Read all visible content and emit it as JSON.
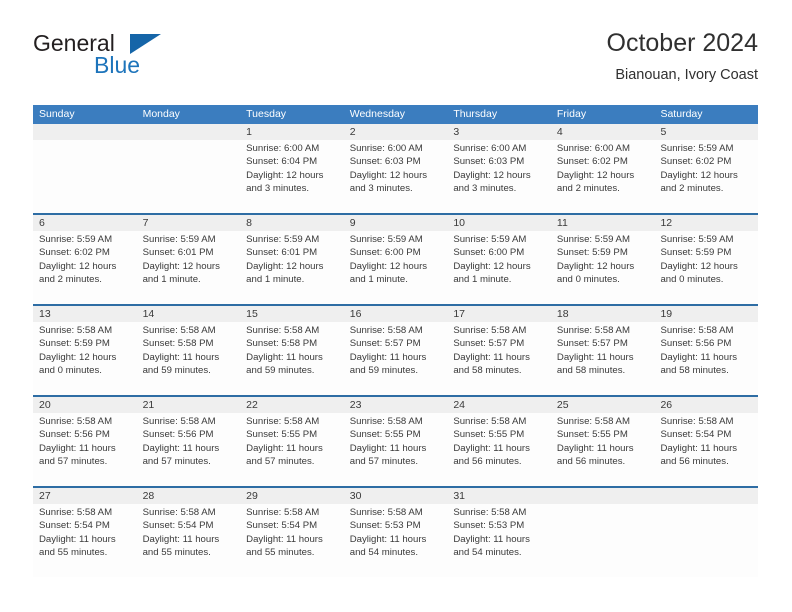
{
  "brand": {
    "name_part1": "General",
    "name_part2": "Blue",
    "flag_icon": "blue-triangle-flag"
  },
  "header": {
    "title": "October 2024",
    "subtitle": "Bianouan, Ivory Coast"
  },
  "colors": {
    "header_blue": "#3b7dbf",
    "rule_blue": "#2e6da4",
    "daynum_band": "#efefef",
    "brand_blue": "#1d74bb",
    "text": "#3a3a3a"
  },
  "weekday_headers": [
    "Sunday",
    "Monday",
    "Tuesday",
    "Wednesday",
    "Thursday",
    "Friday",
    "Saturday"
  ],
  "weeks": [
    {
      "days": [
        {
          "num": "",
          "lines": [
            "",
            "",
            "",
            ""
          ]
        },
        {
          "num": "",
          "lines": [
            "",
            "",
            "",
            ""
          ]
        },
        {
          "num": "1",
          "lines": [
            "Sunrise: 6:00 AM",
            "Sunset: 6:04 PM",
            "Daylight: 12 hours",
            "and 3 minutes."
          ]
        },
        {
          "num": "2",
          "lines": [
            "Sunrise: 6:00 AM",
            "Sunset: 6:03 PM",
            "Daylight: 12 hours",
            "and 3 minutes."
          ]
        },
        {
          "num": "3",
          "lines": [
            "Sunrise: 6:00 AM",
            "Sunset: 6:03 PM",
            "Daylight: 12 hours",
            "and 3 minutes."
          ]
        },
        {
          "num": "4",
          "lines": [
            "Sunrise: 6:00 AM",
            "Sunset: 6:02 PM",
            "Daylight: 12 hours",
            "and 2 minutes."
          ]
        },
        {
          "num": "5",
          "lines": [
            "Sunrise: 5:59 AM",
            "Sunset: 6:02 PM",
            "Daylight: 12 hours",
            "and 2 minutes."
          ]
        }
      ]
    },
    {
      "days": [
        {
          "num": "6",
          "lines": [
            "Sunrise: 5:59 AM",
            "Sunset: 6:02 PM",
            "Daylight: 12 hours",
            "and 2 minutes."
          ]
        },
        {
          "num": "7",
          "lines": [
            "Sunrise: 5:59 AM",
            "Sunset: 6:01 PM",
            "Daylight: 12 hours",
            "and 1 minute."
          ]
        },
        {
          "num": "8",
          "lines": [
            "Sunrise: 5:59 AM",
            "Sunset: 6:01 PM",
            "Daylight: 12 hours",
            "and 1 minute."
          ]
        },
        {
          "num": "9",
          "lines": [
            "Sunrise: 5:59 AM",
            "Sunset: 6:00 PM",
            "Daylight: 12 hours",
            "and 1 minute."
          ]
        },
        {
          "num": "10",
          "lines": [
            "Sunrise: 5:59 AM",
            "Sunset: 6:00 PM",
            "Daylight: 12 hours",
            "and 1 minute."
          ]
        },
        {
          "num": "11",
          "lines": [
            "Sunrise: 5:59 AM",
            "Sunset: 5:59 PM",
            "Daylight: 12 hours",
            "and 0 minutes."
          ]
        },
        {
          "num": "12",
          "lines": [
            "Sunrise: 5:59 AM",
            "Sunset: 5:59 PM",
            "Daylight: 12 hours",
            "and 0 minutes."
          ]
        }
      ]
    },
    {
      "days": [
        {
          "num": "13",
          "lines": [
            "Sunrise: 5:58 AM",
            "Sunset: 5:59 PM",
            "Daylight: 12 hours",
            "and 0 minutes."
          ]
        },
        {
          "num": "14",
          "lines": [
            "Sunrise: 5:58 AM",
            "Sunset: 5:58 PM",
            "Daylight: 11 hours",
            "and 59 minutes."
          ]
        },
        {
          "num": "15",
          "lines": [
            "Sunrise: 5:58 AM",
            "Sunset: 5:58 PM",
            "Daylight: 11 hours",
            "and 59 minutes."
          ]
        },
        {
          "num": "16",
          "lines": [
            "Sunrise: 5:58 AM",
            "Sunset: 5:57 PM",
            "Daylight: 11 hours",
            "and 59 minutes."
          ]
        },
        {
          "num": "17",
          "lines": [
            "Sunrise: 5:58 AM",
            "Sunset: 5:57 PM",
            "Daylight: 11 hours",
            "and 58 minutes."
          ]
        },
        {
          "num": "18",
          "lines": [
            "Sunrise: 5:58 AM",
            "Sunset: 5:57 PM",
            "Daylight: 11 hours",
            "and 58 minutes."
          ]
        },
        {
          "num": "19",
          "lines": [
            "Sunrise: 5:58 AM",
            "Sunset: 5:56 PM",
            "Daylight: 11 hours",
            "and 58 minutes."
          ]
        }
      ]
    },
    {
      "days": [
        {
          "num": "20",
          "lines": [
            "Sunrise: 5:58 AM",
            "Sunset: 5:56 PM",
            "Daylight: 11 hours",
            "and 57 minutes."
          ]
        },
        {
          "num": "21",
          "lines": [
            "Sunrise: 5:58 AM",
            "Sunset: 5:56 PM",
            "Daylight: 11 hours",
            "and 57 minutes."
          ]
        },
        {
          "num": "22",
          "lines": [
            "Sunrise: 5:58 AM",
            "Sunset: 5:55 PM",
            "Daylight: 11 hours",
            "and 57 minutes."
          ]
        },
        {
          "num": "23",
          "lines": [
            "Sunrise: 5:58 AM",
            "Sunset: 5:55 PM",
            "Daylight: 11 hours",
            "and 57 minutes."
          ]
        },
        {
          "num": "24",
          "lines": [
            "Sunrise: 5:58 AM",
            "Sunset: 5:55 PM",
            "Daylight: 11 hours",
            "and 56 minutes."
          ]
        },
        {
          "num": "25",
          "lines": [
            "Sunrise: 5:58 AM",
            "Sunset: 5:55 PM",
            "Daylight: 11 hours",
            "and 56 minutes."
          ]
        },
        {
          "num": "26",
          "lines": [
            "Sunrise: 5:58 AM",
            "Sunset: 5:54 PM",
            "Daylight: 11 hours",
            "and 56 minutes."
          ]
        }
      ]
    },
    {
      "days": [
        {
          "num": "27",
          "lines": [
            "Sunrise: 5:58 AM",
            "Sunset: 5:54 PM",
            "Daylight: 11 hours",
            "and 55 minutes."
          ]
        },
        {
          "num": "28",
          "lines": [
            "Sunrise: 5:58 AM",
            "Sunset: 5:54 PM",
            "Daylight: 11 hours",
            "and 55 minutes."
          ]
        },
        {
          "num": "29",
          "lines": [
            "Sunrise: 5:58 AM",
            "Sunset: 5:54 PM",
            "Daylight: 11 hours",
            "and 55 minutes."
          ]
        },
        {
          "num": "30",
          "lines": [
            "Sunrise: 5:58 AM",
            "Sunset: 5:53 PM",
            "Daylight: 11 hours",
            "and 54 minutes."
          ]
        },
        {
          "num": "31",
          "lines": [
            "Sunrise: 5:58 AM",
            "Sunset: 5:53 PM",
            "Daylight: 11 hours",
            "and 54 minutes."
          ]
        },
        {
          "num": "",
          "lines": [
            "",
            "",
            "",
            ""
          ]
        },
        {
          "num": "",
          "lines": [
            "",
            "",
            "",
            ""
          ]
        }
      ]
    }
  ]
}
